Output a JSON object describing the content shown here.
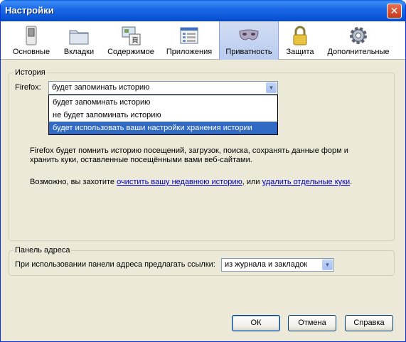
{
  "window": {
    "title": "Настройки",
    "close_label": "✕"
  },
  "panes": [
    {
      "label": "Основные",
      "icon": "switch-icon"
    },
    {
      "label": "Вкладки",
      "icon": "tabs-folder-icon"
    },
    {
      "label": "Содержимое",
      "icon": "content-icon"
    },
    {
      "label": "Приложения",
      "icon": "applications-icon"
    },
    {
      "label": "Приватность",
      "icon": "mask-icon",
      "selected": true
    },
    {
      "label": "Защита",
      "icon": "padlock-icon"
    },
    {
      "label": "Дополнительные",
      "icon": "gear-icon"
    }
  ],
  "history": {
    "caption": "История",
    "firefox_label": "Firefox:",
    "selected_value": "будет запоминать историю",
    "options": [
      "будет запоминать историю",
      "не будет запоминать историю",
      "будет использовать ваши настройки хранения истории"
    ],
    "highlighted_option": 2,
    "description_line1": "Firefox будет помнить историю посещений, загрузок, поиска, сохранять данные форм и",
    "description_line2": "хранить куки, оставленные посещёнными вами веб-сайтами.",
    "hint_prefix": "Возможно, вы захотите ",
    "clear_history_link": "очистить вашу недавнюю историю",
    "hint_middle": ", или ",
    "remove_cookies_link": "удалить отдельные куки",
    "hint_suffix": "."
  },
  "address_bar": {
    "caption": "Панель адреса",
    "suggest_label": "При использовании панели адреса предлагать ссылки:",
    "suggest_value": "из журнала и закладок"
  },
  "buttons": {
    "ok": "ОК",
    "cancel": "Отмена",
    "help": "Справка"
  },
  "colors": {
    "title_bar": "#0853d6",
    "selection": "#316ac5",
    "dialog_bg": "#ece9d8",
    "link": "#0000cc"
  }
}
